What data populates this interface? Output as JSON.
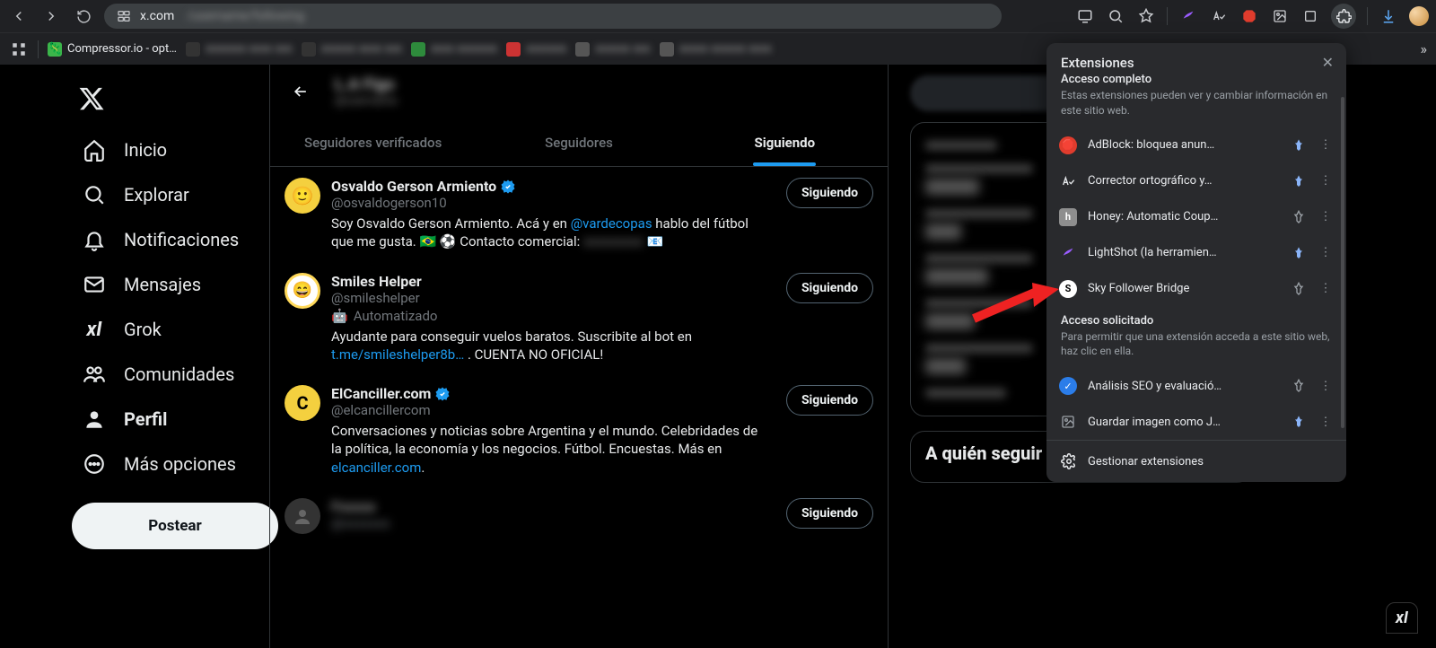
{
  "browser": {
    "url": "x.com",
    "bookmark_label": "Compressor.io - opt…"
  },
  "extensions_popup": {
    "title": "Extensiones",
    "full_access_heading": "Acceso completo",
    "full_access_desc": "Estas extensiones pueden ver y cambiar información en este sitio web.",
    "items_full": [
      {
        "name": "AdBlock: bloquea anun…",
        "pinned": true,
        "color": "#e03c2d"
      },
      {
        "name": "Corrector ortográfico y…",
        "pinned": true,
        "color": "#ffffff"
      },
      {
        "name": "Honey: Automatic Coup…",
        "pinned": false,
        "color": "#8e8e8e"
      },
      {
        "name": "LightShot (la herramien…",
        "pinned": true,
        "color": "#9a5cff"
      },
      {
        "name": "Sky Follower Bridge",
        "pinned": false,
        "color": "#ffffff"
      }
    ],
    "requested_heading": "Acceso solicitado",
    "requested_desc": "Para permitir que una extensión acceda a este sitio web, haz clic en ella.",
    "items_requested": [
      {
        "name": "Análisis SEO y evaluació…",
        "pinned": false,
        "color": "#2b7de9"
      },
      {
        "name": "Guardar imagen como J…",
        "pinned": true,
        "color": "#555"
      }
    ],
    "manage_label": "Gestionar extensiones"
  },
  "nav": {
    "items": [
      {
        "label": "Inicio",
        "icon": "home"
      },
      {
        "label": "Explorar",
        "icon": "search"
      },
      {
        "label": "Notificaciones",
        "icon": "bell"
      },
      {
        "label": "Mensajes",
        "icon": "mail"
      },
      {
        "label": "Grok",
        "icon": "grok"
      },
      {
        "label": "Comunidades",
        "icon": "community"
      },
      {
        "label": "Perfil",
        "icon": "user",
        "active": true
      },
      {
        "label": "Más opciones",
        "icon": "more"
      }
    ],
    "post_label": "Postear"
  },
  "tabs": {
    "verified": "Seguidores verificados",
    "followers": "Seguidores",
    "following": "Siguiendo"
  },
  "following_button_label": "Siguiendo",
  "users": [
    {
      "name": "Osvaldo Gerson Armiento",
      "handle": "@osvaldogerson10",
      "verified": true,
      "bio_pre": "Soy Osvaldo Gerson Armiento. Acá y en ",
      "bio_link": "@vardecopas",
      "bio_post": " hablo del fútbol que me gusta. 🇧🇷 ⚽ Contacto comercial: ",
      "bio_tail_icon": "📧"
    },
    {
      "name": "Smiles Helper",
      "handle": "@smileshelper",
      "automated": "Automatizado",
      "bio_pre": "Ayudante para conseguir vuelos baratos. Suscribite al bot en ",
      "bio_link": "t.me/smileshelper8b…",
      "bio_post": " . CUENTA NO OFICIAL!"
    },
    {
      "name": "ElCanciller.com",
      "handle": "@elcancillercom",
      "verified": true,
      "bio_pre": "Conversaciones y noticias sobre Argentina y el mundo. Celebridades de la política, la economía y los negocios. Fútbol. Encuestas. Más en ",
      "bio_link": "elcanciller.com",
      "bio_post": "."
    }
  ],
  "right_panel": {
    "who_to_follow": "A quién seguir"
  }
}
